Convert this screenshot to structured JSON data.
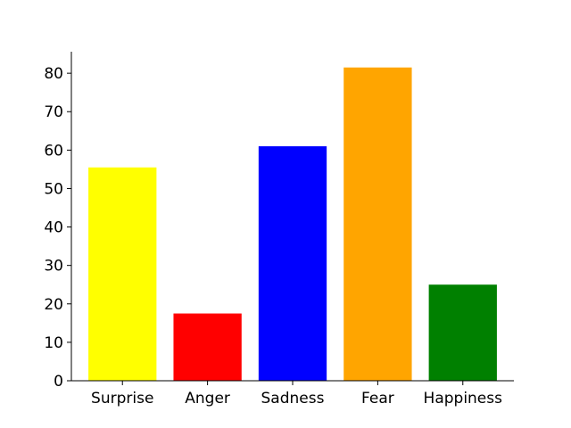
{
  "chart_data": {
    "type": "bar",
    "categories": [
      "Surprise",
      "Anger",
      "Sadness",
      "Fear",
      "Happiness"
    ],
    "values": [
      55.5,
      17.5,
      61,
      81.5,
      25
    ],
    "colors": [
      "#ffff00",
      "#ff0000",
      "#0000ff",
      "#ffa500",
      "#008000"
    ],
    "title": "",
    "xlabel": "",
    "ylabel": "",
    "ylim": [
      0,
      85.6
    ],
    "yticks": [
      0,
      10,
      20,
      30,
      40,
      50,
      60,
      70,
      80
    ],
    "grid": false,
    "legend": "none"
  }
}
